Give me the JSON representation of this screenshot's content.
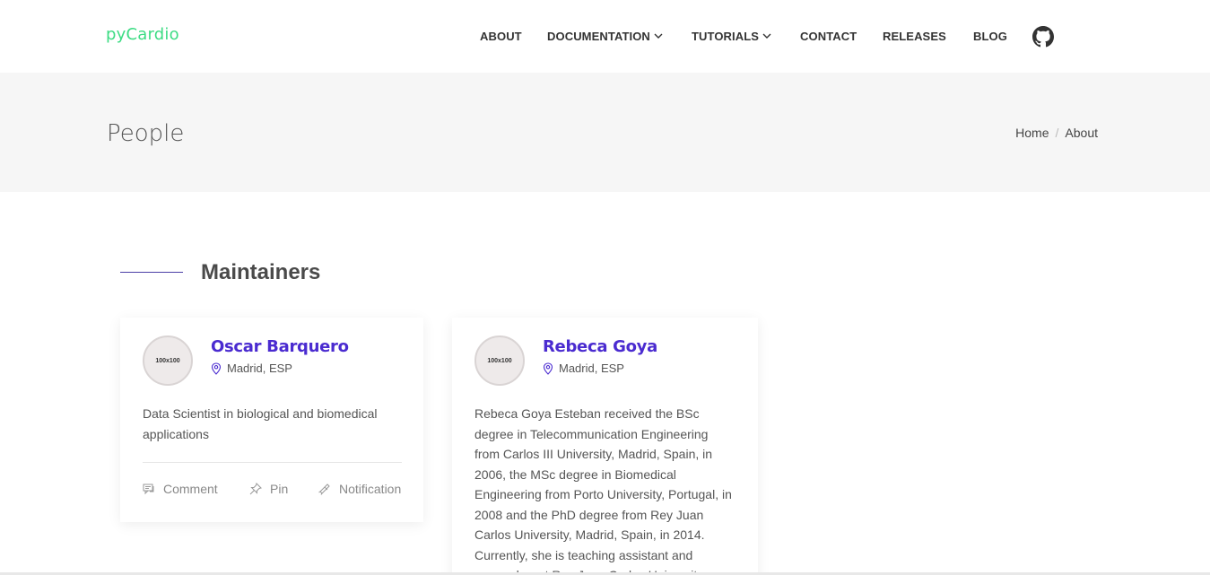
{
  "brand": "pyCardio",
  "nav": {
    "about": "ABOUT",
    "documentation": "DOCUMENTATION",
    "tutorials": "TUTORIALS",
    "contact": "CONTACT",
    "releases": "RELEASES",
    "blog": "BLOG",
    "github_icon": "github-icon"
  },
  "banner": {
    "title": "People",
    "breadcrumb": [
      "Home",
      "About"
    ]
  },
  "section": {
    "title": "Maintainers"
  },
  "people": [
    {
      "avatar_text": "100x100",
      "name": "Oscar Barquero",
      "location": "Madrid, ESP",
      "bio": "Data Scientist in biological and biomedical applications",
      "actions": [
        "Comment",
        "Pin",
        "Notification"
      ]
    },
    {
      "avatar_text": "100x100",
      "name": "Rebeca Goya",
      "location": "Madrid, ESP",
      "bio": "Rebeca Goya Esteban received the BSc degree in Telecommunication Engineering from Carlos III University, Madrid, Spain, in 2006, the MSc degree in Biomedical Engineering from Porto University, Portugal, in 2008 and the PhD degree from Rey Juan Carlos University, Madrid, Spain, in 2014. Currently, she is teaching assistant and researcher at Rey Juan Carlos University."
    }
  ],
  "colors": {
    "brand": "#3ddc84",
    "name_link": "#4a2bd0",
    "accent_line": "#4b3fa6",
    "banner_bg": "#f6f6f6"
  }
}
